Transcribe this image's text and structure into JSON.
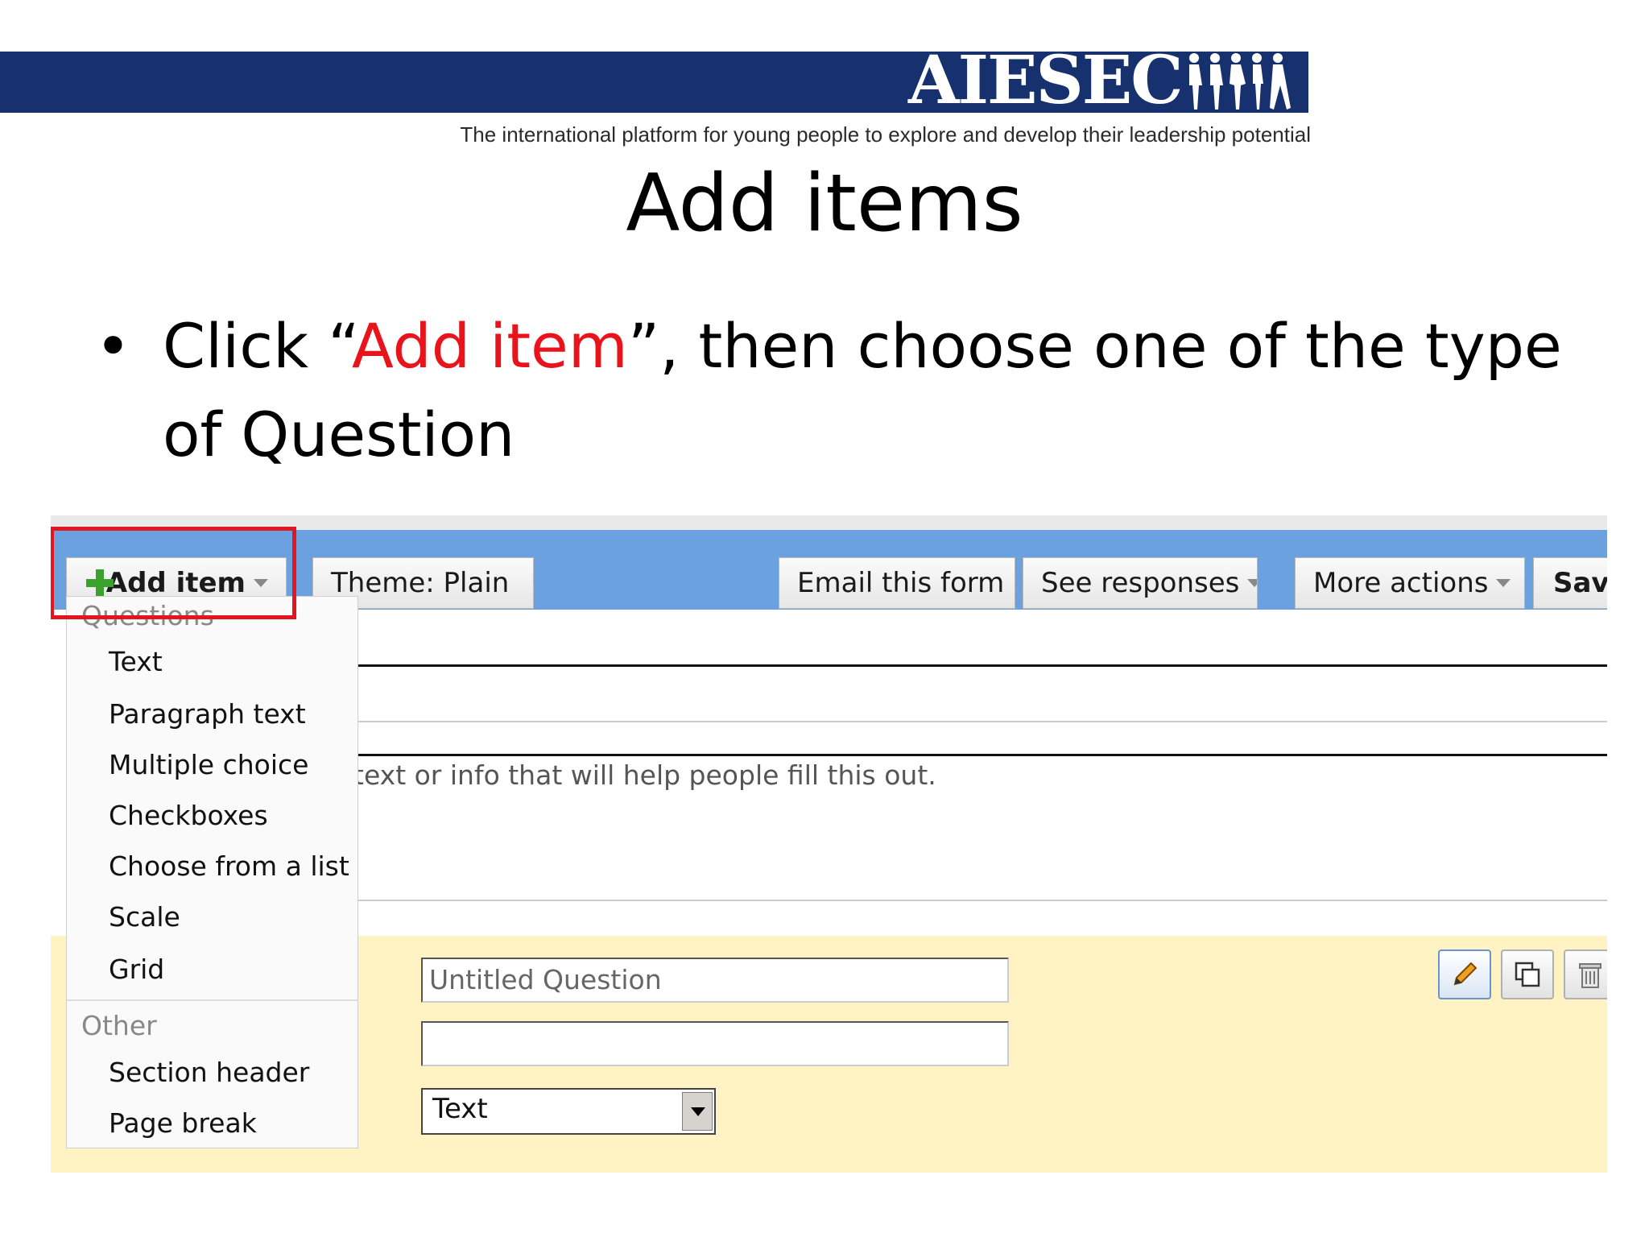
{
  "header": {
    "logo_text": "AIESEC",
    "tagline": "The international platform for young people to explore and develop their leadership potential"
  },
  "slide": {
    "title": "Add items",
    "bullet_pre": "Click “",
    "bullet_highlight": "Add item",
    "bullet_post": "”, then choose one of the type of Question",
    "bullet_symbol": "•"
  },
  "toolbar": {
    "add_item": "Add item",
    "theme": "Theme:  Plain",
    "email": "Email this form",
    "responses": "See responses",
    "more_actions": "More actions",
    "save": "Save"
  },
  "form": {
    "description_placeholder": "text or info that will help people fill this out.",
    "question_title_placeholder": "Untitled Question",
    "question_type_value": "Text"
  },
  "menu": {
    "questions_header": "Questions",
    "question_items": [
      "Text",
      "Paragraph text",
      "Multiple choice",
      "Checkboxes",
      "Choose from a list",
      "Scale",
      "Grid"
    ],
    "other_header": "Other",
    "other_items": [
      "Section header",
      "Page break"
    ]
  },
  "colors": {
    "banner": "#16316e",
    "toolbar": "#6aa1de",
    "highlight": "#e8131b",
    "question_bg": "#fff3c4"
  }
}
